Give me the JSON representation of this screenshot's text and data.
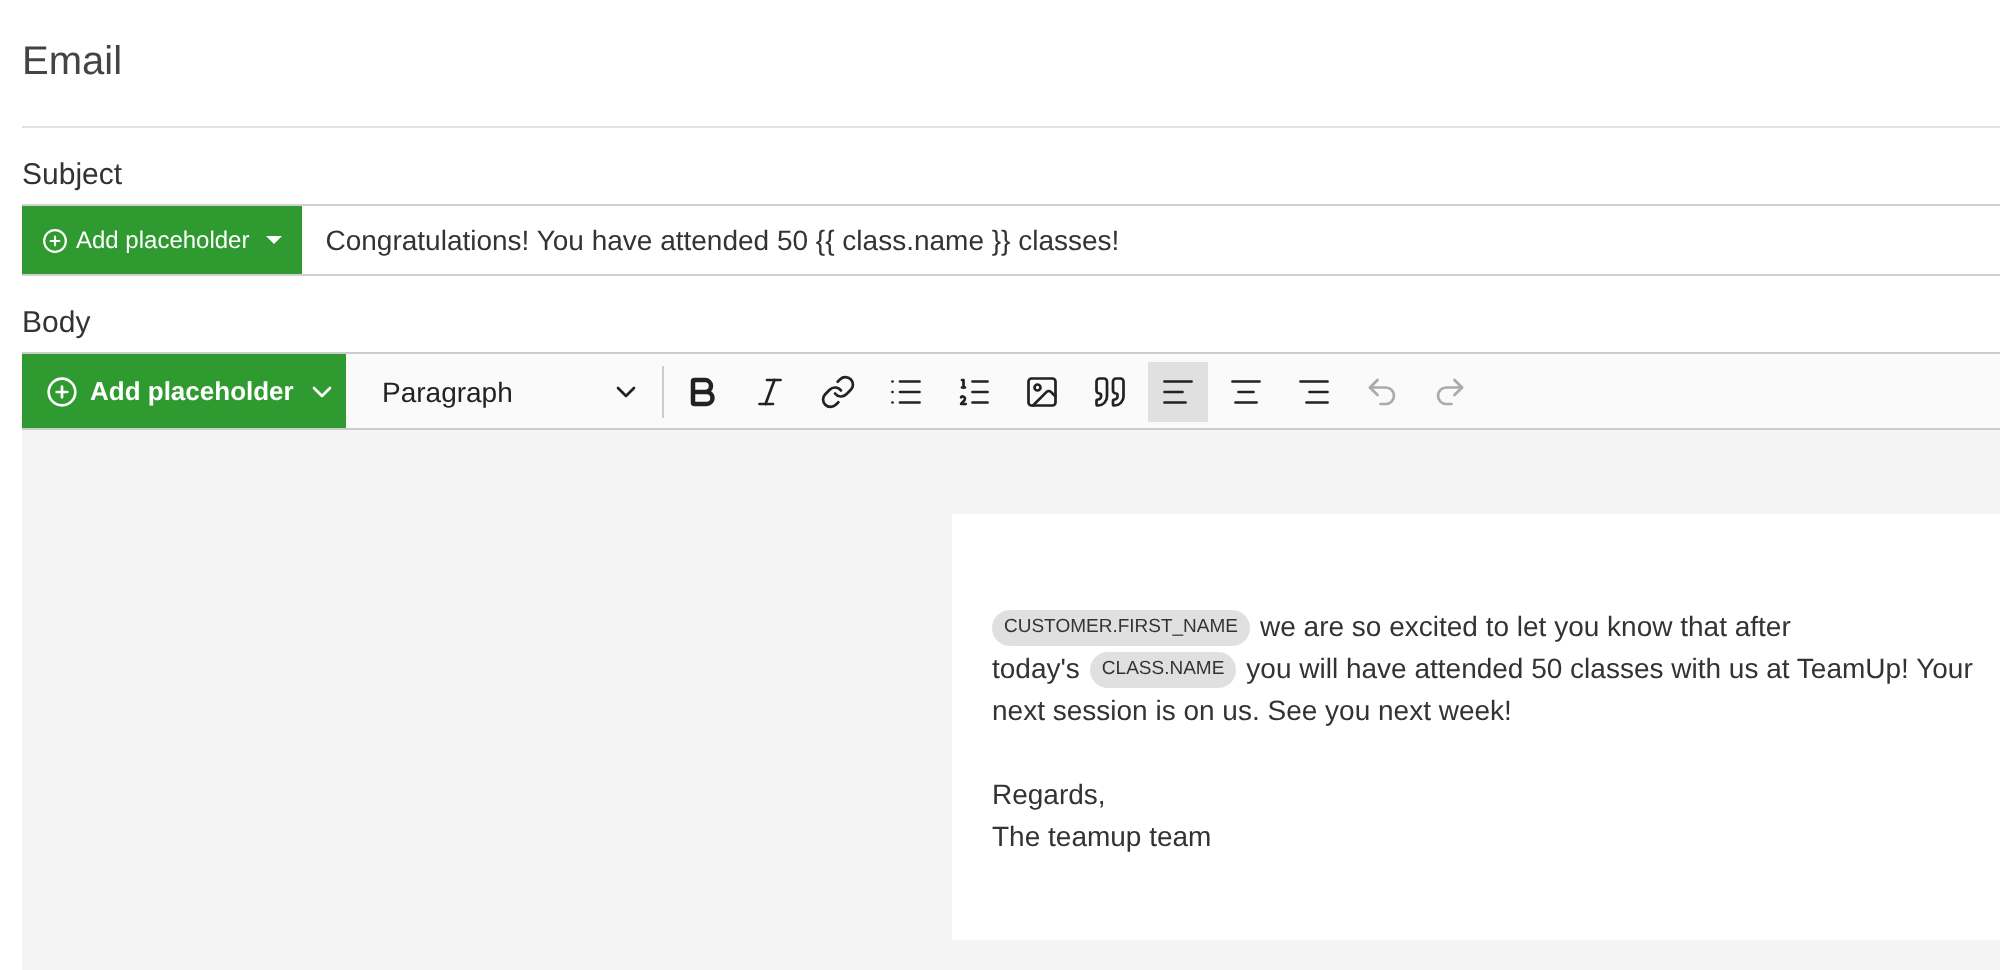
{
  "title": "Email",
  "subject": {
    "label": "Subject",
    "button": "Add placeholder",
    "value": "Congratulations! You have attended 50 {{ class.name }} classes!"
  },
  "body": {
    "label": "Body",
    "button": "Add placeholder",
    "block_format": "Paragraph",
    "tools": [
      {
        "kind": "bold",
        "selected": false,
        "disabled": false
      },
      {
        "kind": "italic",
        "selected": false,
        "disabled": false
      },
      {
        "kind": "link",
        "selected": false,
        "disabled": false
      },
      {
        "kind": "bullet-list",
        "selected": false,
        "disabled": false
      },
      {
        "kind": "numbered-list",
        "selected": false,
        "disabled": false
      },
      {
        "kind": "image",
        "selected": false,
        "disabled": false
      },
      {
        "kind": "quote",
        "selected": false,
        "disabled": false
      },
      {
        "kind": "align-left",
        "selected": true,
        "disabled": false
      },
      {
        "kind": "align-center",
        "selected": false,
        "disabled": false
      },
      {
        "kind": "align-right",
        "selected": false,
        "disabled": false
      },
      {
        "kind": "undo",
        "selected": false,
        "disabled": true
      },
      {
        "kind": "redo",
        "selected": false,
        "disabled": true
      }
    ],
    "paragraphs": [
      [
        [
          {
            "kind": "chip",
            "text": "CUSTOMER.FIRST_NAME"
          },
          {
            "kind": "text",
            "text": "we are so excited to let you know that after"
          }
        ],
        [
          {
            "kind": "text",
            "text": "today's"
          },
          {
            "kind": "chip",
            "text": "CLASS.NAME"
          },
          {
            "kind": "text",
            "text": "you will have attended 50 classes with us at  TeamUp! Your"
          }
        ],
        [
          {
            "kind": "text",
            "text": "next session is on us. See you next week!"
          }
        ]
      ],
      [
        [
          {
            "kind": "text",
            "text": "Regards,"
          }
        ],
        [
          {
            "kind": "text",
            "text": "The teamup team"
          }
        ]
      ]
    ]
  }
}
